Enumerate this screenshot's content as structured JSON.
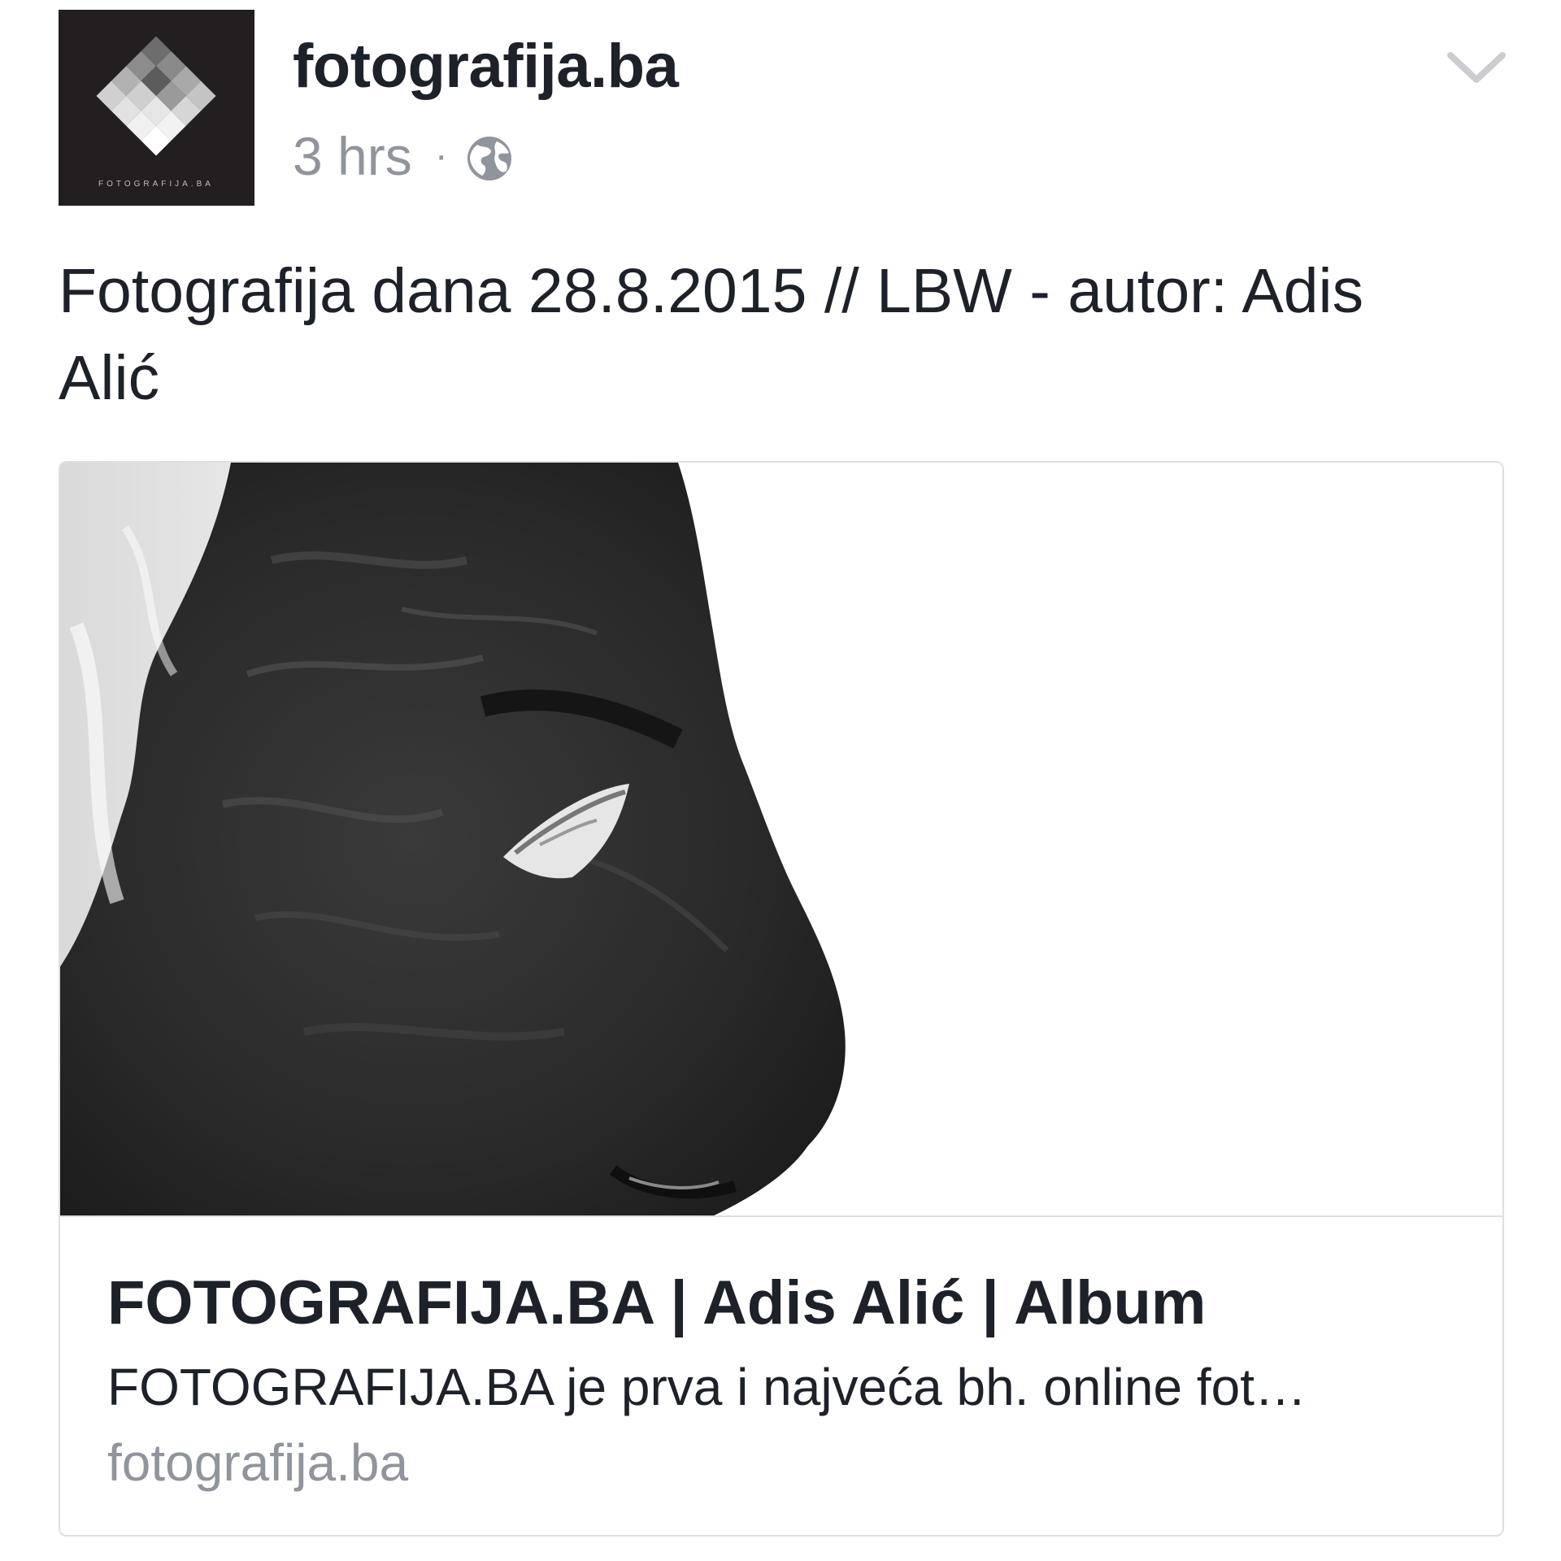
{
  "post": {
    "page_name": "fotografija.ba",
    "timestamp": "3 hrs",
    "separator": "·",
    "privacy_icon": "globe-icon",
    "menu_icon": "chevron-down-icon",
    "avatar_logo_text": "FOTOGRAFIJA.BA",
    "status_text": "Fotografija dana 28.8.2015 // LBW - autor: Adis Alić"
  },
  "link_card": {
    "title": "FOTOGRAFIJA.BA | Adis Alić | Album",
    "description": "FOTOGRAFIJA.BA je prva i najveća bh. online fot…",
    "domain": "fotografija.ba"
  },
  "colors": {
    "primary_text": "#1d2129",
    "secondary_text": "#90949c",
    "border": "#dddfe2",
    "avatar_background": "#231f20"
  }
}
